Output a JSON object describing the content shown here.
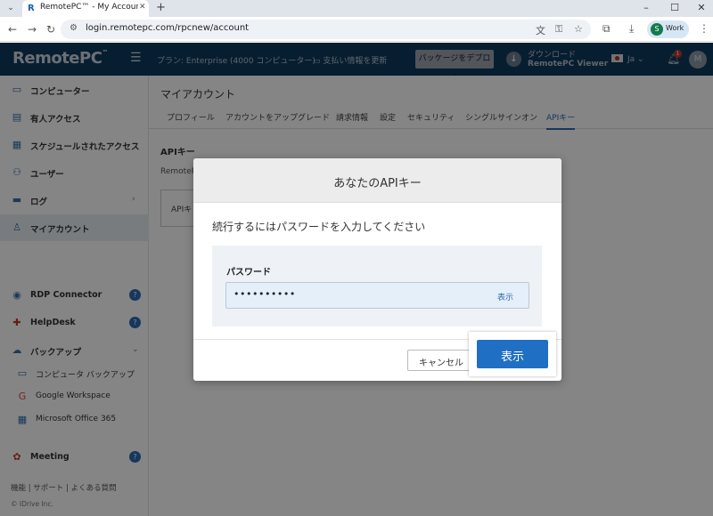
{
  "browser": {
    "tab_title": "RemotePC™ - My Account Info",
    "tab_favicon": "R",
    "url": "login.remotepc.com/rpcnew/account",
    "profile_initial": "S",
    "profile_name": "Work",
    "icons": [
      "tab-menu-icon",
      "close-icon",
      "new-tab-icon",
      "back-icon",
      "forward-icon",
      "reload-icon",
      "site-info-icon",
      "translate-icon",
      "password-key-icon",
      "star-icon",
      "extensions-icon",
      "download-icon",
      "menu-icon",
      "minimize-icon",
      "maximize-icon"
    ]
  },
  "header": {
    "logo": "RemotePC",
    "logo_tm": "™",
    "plan": "プラン: Enterprise (4000 コンピューター)",
    "billing": "支払い情報を更新",
    "deploy_button": "パッケージをデプロイ",
    "download_line1": "ダウンロード",
    "download_line2": "RemotePC Viewer",
    "language": "Ja",
    "notification_count": "1",
    "avatar_initial": "M"
  },
  "sidebar": {
    "items": [
      {
        "label": "コンピューター",
        "icon": "monitor-icon"
      },
      {
        "label": "有人アクセス",
        "icon": "attended-access-icon"
      },
      {
        "label": "スケジュールされたアクセス",
        "icon": "calendar-icon"
      },
      {
        "label": "ユーザー",
        "icon": "users-icon"
      },
      {
        "label": "ログ",
        "icon": "logs-icon"
      },
      {
        "label": "マイアカウント",
        "icon": "account-icon"
      },
      {
        "label": "RDP Connector",
        "icon": "rdp-icon"
      },
      {
        "label": "HelpDesk",
        "icon": "helpdesk-icon"
      },
      {
        "label": "バックアップ",
        "icon": "backup-icon"
      },
      {
        "label": "コンピュータ バックアップ",
        "icon": "computer-backup-icon"
      },
      {
        "label": "Google Workspace",
        "icon": "google-icon"
      },
      {
        "label": "Microsoft Office 365",
        "icon": "microsoft-icon"
      },
      {
        "label": "Meeting",
        "icon": "meeting-icon"
      }
    ],
    "help_glyph": "?",
    "footer_links": [
      "機能",
      "サポート",
      "よくある質問"
    ],
    "copyright": "© IDrive Inc."
  },
  "main": {
    "title": "マイアカウント",
    "tabs": [
      "プロフィール",
      "アカウントをアップグレード",
      "請求情報",
      "設定",
      "セキュリティ",
      "シングルサインオン",
      "APIキー"
    ],
    "active_tab": "APIキー",
    "section_title": "APIキー",
    "section_text": "RemoteP",
    "api_box_label": "APIキ"
  },
  "modal": {
    "title": "あなたのAPIキー",
    "message": "続行するにはパスワードを入力してください",
    "password_label": "パスワード",
    "password_value": "••••••••••",
    "show_link": "表示",
    "cancel_button": "キャンセル",
    "primary_button": "表示"
  }
}
